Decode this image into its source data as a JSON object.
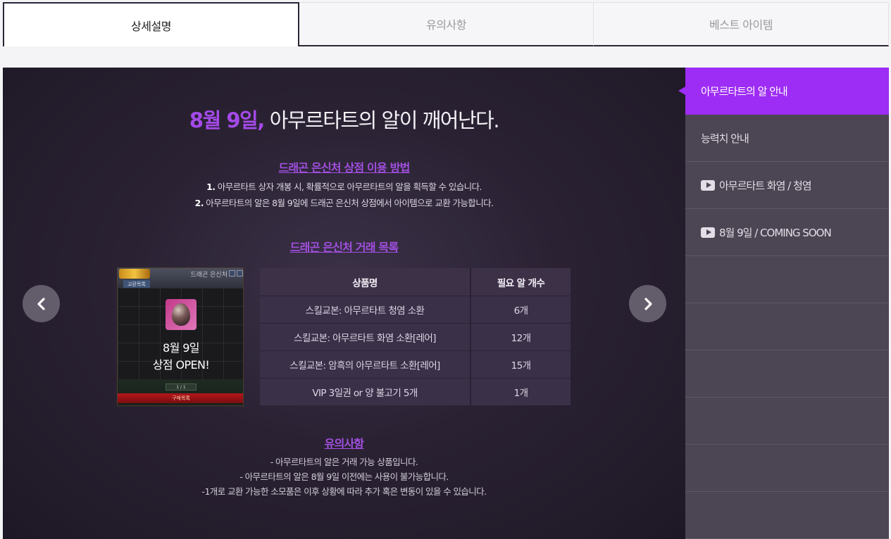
{
  "tabs": [
    {
      "label": "상세설명",
      "active": true
    },
    {
      "label": "유의사항",
      "active": false
    },
    {
      "label": "베스트 아이템",
      "active": false
    }
  ],
  "main": {
    "headline_date": "8월 9일,",
    "headline_text": "아무르타트의 알이 깨어난다.",
    "usage": {
      "title": "드래곤 은신처 상점 이용 방법",
      "lines": [
        {
          "num": "1.",
          "text": "아무르타트 상자 개봉 시, 확률적으로 아무르타트의 알을 획득할 수 있습니다."
        },
        {
          "num": "2.",
          "text": "아무르타트의 알은 8월 9일에 드래곤 은신처 상점에서 아이템으로 교환 가능합니다."
        }
      ]
    },
    "trade": {
      "title": "드래곤 은신처 거래 목록",
      "headers": [
        "상품명",
        "필요 알 개수"
      ],
      "rows": [
        [
          "스킬교본: 아무르타트 청염 소환",
          "6개"
        ],
        [
          "스킬교본: 아무르타트 화염 소환[레어]",
          "12개"
        ],
        [
          "스킬교본: 암흑의 아무르타트 소환[레어]",
          "15개"
        ],
        [
          "VIP 3일권 or 양 불고기 5개",
          "1개"
        ]
      ]
    },
    "shop_preview": {
      "logo": "",
      "title": "드래곤 은신처",
      "subtab": "교환목록",
      "overlay_line1": "8월 9일",
      "overlay_line2": "상점 OPEN!",
      "page": "1 / 1",
      "buy_label": "구매목록"
    },
    "notice": {
      "title": "유의사항",
      "lines": [
        "- 아무르타트의 알은 거래 가능 상품입니다.",
        "- 아무르타트의 알은 8월 9일 이전에는 사용이 불가능합니다.",
        "-1개로 교환 가능한 소모품은 이후 상황에 따라 추가 혹은 변동이 있을 수 있습니다."
      ]
    }
  },
  "sidebar": {
    "items": [
      {
        "label": "아무르타트의 알 안내",
        "active": true,
        "icon": null
      },
      {
        "label": "능력치 안내",
        "active": false,
        "icon": null
      },
      {
        "label": "아무르타트 화염 / 청염",
        "active": false,
        "icon": "play-icon"
      },
      {
        "label": "8월 9일 / COMING SOON",
        "active": false,
        "icon": "play-icon"
      },
      {
        "label": "",
        "active": false,
        "icon": null
      },
      {
        "label": "",
        "active": false,
        "icon": null
      },
      {
        "label": "",
        "active": false,
        "icon": null
      },
      {
        "label": "",
        "active": false,
        "icon": null
      },
      {
        "label": "",
        "active": false,
        "icon": null
      },
      {
        "label": "",
        "active": false,
        "icon": null
      }
    ]
  },
  "colors": {
    "accent": "#9d2cf4",
    "highlight_text": "#a44ae8",
    "sidebar_bg": "#4c4553",
    "main_bg": "#2a2233"
  }
}
